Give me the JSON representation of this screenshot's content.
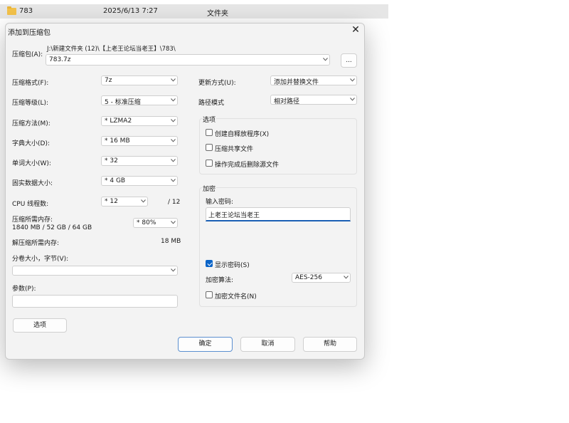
{
  "explorer_row": {
    "name": "783",
    "date": "2025/6/13 7:27",
    "type": "文件夹"
  },
  "dialog": {
    "title": "添加到压缩包",
    "archive_label": "压缩包(A):",
    "archive_path": "J:\\新建文件夹 (12)\\【上老王论坛当老王】\\783\\",
    "archive_name": "783.7z",
    "browse_label": "...",
    "left": {
      "format": {
        "label": "压缩格式(F):",
        "value": "7z"
      },
      "level": {
        "label": "压缩等级(L):",
        "value": "5 - 标准压缩"
      },
      "method": {
        "label": "压缩方法(M):",
        "value": "* LZMA2"
      },
      "dict": {
        "label": "字典大小(D):",
        "value": "* 16 MB"
      },
      "word": {
        "label": "单词大小(W):",
        "value": "* 32"
      },
      "solid": {
        "label": "固实数据大小:",
        "value": "* 4 GB"
      },
      "threads": {
        "label": "CPU 线程数:",
        "value": "* 12",
        "max": "/ 12"
      },
      "mem_label": "压缩所需内存:",
      "mem_value": "1840 MB / 52 GB / 64 GB",
      "mem_percent": "* 80%",
      "decomp_label": "解压缩所需内存:",
      "decomp_value": "18 MB",
      "split_label": "分卷大小，字节(V):",
      "split_value": "",
      "params_label": "参数(P):",
      "params_value": "",
      "options_button": "选项"
    },
    "right": {
      "update": {
        "label": "更新方式(U):",
        "value": "添加并替换文件"
      },
      "pathmode": {
        "label": "路径模式",
        "value": "相对路径"
      },
      "options_group": "选项",
      "opt_sfx": "创建自释放程序(X)",
      "opt_shared": "压缩共享文件",
      "opt_delete": "操作完成后删除源文件",
      "encrypt_group": "加密",
      "password_label": "输入密码:",
      "password_value": "上老王论坛当老王",
      "show_password": "显示密码(S)",
      "show_password_checked": true,
      "method_label": "加密算法:",
      "method_value": "AES-256",
      "encrypt_names": "加密文件名(N)"
    },
    "buttons": {
      "ok": "确定",
      "cancel": "取消",
      "help": "帮助"
    }
  },
  "colors": {
    "accent": "#0a64c8",
    "dialog_bg": "#f3f3f3",
    "folder": "#f3c24a"
  }
}
